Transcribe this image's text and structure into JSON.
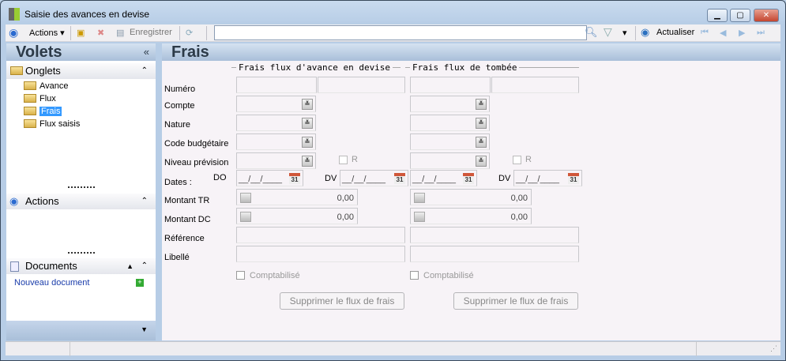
{
  "window": {
    "title": "Saisie des avances en devise",
    "minimize": "▁",
    "maximize": "▢",
    "close": "✕"
  },
  "toolbar": {
    "actions": "Actions",
    "save": "Enregistrer",
    "search_value": "",
    "refresh": "Actualiser"
  },
  "left": {
    "title": "Volets",
    "collapse": "«",
    "onglets": {
      "label": "Onglets",
      "items": [
        {
          "label": "Avance"
        },
        {
          "label": "Flux"
        },
        {
          "label": "Frais",
          "selected": true
        },
        {
          "label": "Flux saisis"
        }
      ]
    },
    "actions": {
      "label": "Actions"
    },
    "documents": {
      "label": "Documents",
      "new_doc": "Nouveau document"
    }
  },
  "main": {
    "title": "Frais",
    "groups": [
      {
        "legend": "Frais flux d'avance en devise"
      },
      {
        "legend": "Frais flux de tombée"
      }
    ],
    "labels": {
      "numero": "Numéro",
      "compte": "Compte",
      "nature": "Nature",
      "code": "Code budgétaire",
      "niveau": "Niveau prévision",
      "dates": "Dates :",
      "do": "DO",
      "dv": "DV",
      "mtr": "Montant TR",
      "mdc": "Montant DC",
      "ref": "Référence",
      "libelle": "Libellé"
    },
    "r_label": "R",
    "date_placeholder": "__/__/____",
    "cal": "31",
    "amount_tr": "0,00",
    "amount_dc": "0,00",
    "comptabilise": "Comptabilisé",
    "delete_button": "Supprimer le flux de frais"
  },
  "colors": {
    "accent": "#3399ff",
    "header": "#a9bfd9",
    "form_bg": "#f7f3f7"
  }
}
